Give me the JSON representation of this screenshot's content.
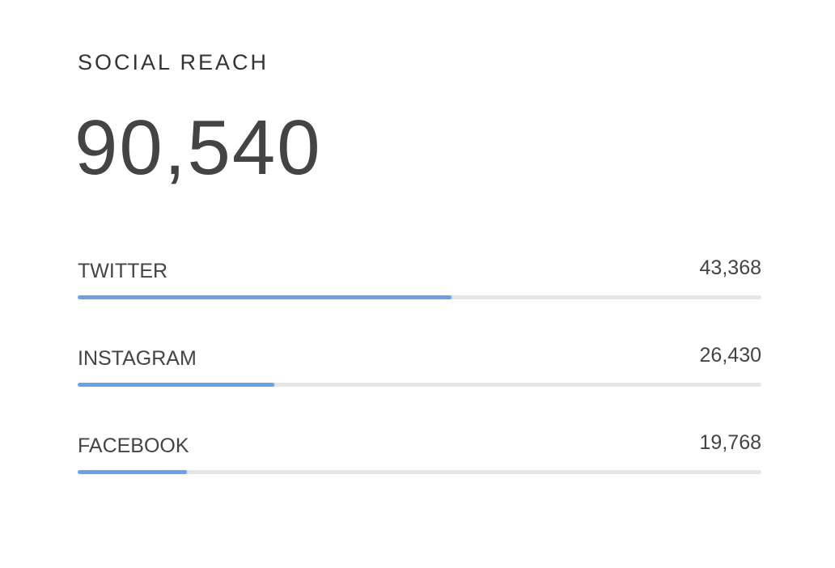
{
  "card": {
    "title": "SOCIAL REACH",
    "total": "90,540",
    "accent_color": "#6aa2ea",
    "track_color": "#e6e6e6",
    "items": [
      {
        "label": "TWITTER",
        "value": "43,368",
        "progress": 0.547
      },
      {
        "label": "INSTAGRAM",
        "value": "26,430",
        "progress": 0.288
      },
      {
        "label": "FACEBOOK",
        "value": "19,768",
        "progress": 0.16
      }
    ]
  }
}
